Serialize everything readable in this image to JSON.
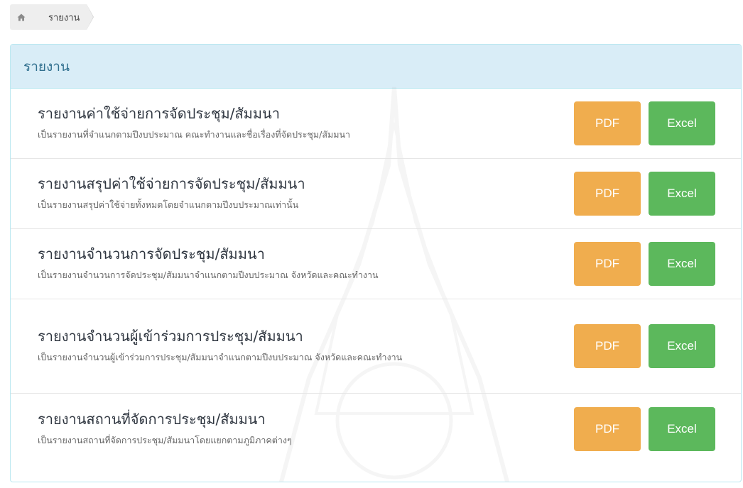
{
  "breadcrumb": {
    "home_icon": "home-icon",
    "current": "รายงาน"
  },
  "panel": {
    "title": "รายงาน"
  },
  "buttons": {
    "pdf_label": "PDF",
    "excel_label": "Excel"
  },
  "colors": {
    "pdf": "#f0ad4e",
    "excel": "#5cb85c",
    "heading_bg": "#d9edf7",
    "heading_text": "#31708f"
  },
  "reports": [
    {
      "title": "รายงานค่าใช้จ่ายการจัดประชุม/สัมมนา",
      "description": "เป็นรายงานที่จำแนกตามปีงบประมาณ คณะทำงานและชื่อเรื่องที่จัดประชุม/สัมมนา"
    },
    {
      "title": "รายงานสรุปค่าใช้จ่ายการจัดประชุม/สัมมนา",
      "description": "เป็นรายงานสรุปค่าใช้จ่ายทั้งหมดโดยจำแนกตามปีงบประมาณเท่านั้น"
    },
    {
      "title": "รายงานจำนวนการจัดประชุม/สัมมนา",
      "description": "เป็นรายงานจำนวนการจัดประชุม/สัมมนาจำแนกตามปีงบประมาณ จังหวัดและคณะทำงาน"
    },
    {
      "title": "รายงานจำนวนผู้เข้าร่วมการประชุม/สัมมนา",
      "description": "เป็นรายงานจำนวนผู้เข้าร่วมการประชุม/สัมมนาจำแนกตามปีงบประมาณ จังหวัดและคณะทำงาน"
    },
    {
      "title": "รายงานสถานที่จัดการประชุม/สัมมนา",
      "description": "เป็นรายงานสถานที่จัดการประชุม/สัมมนาโดยแยกตามภูมิภาคต่างๆ"
    }
  ]
}
